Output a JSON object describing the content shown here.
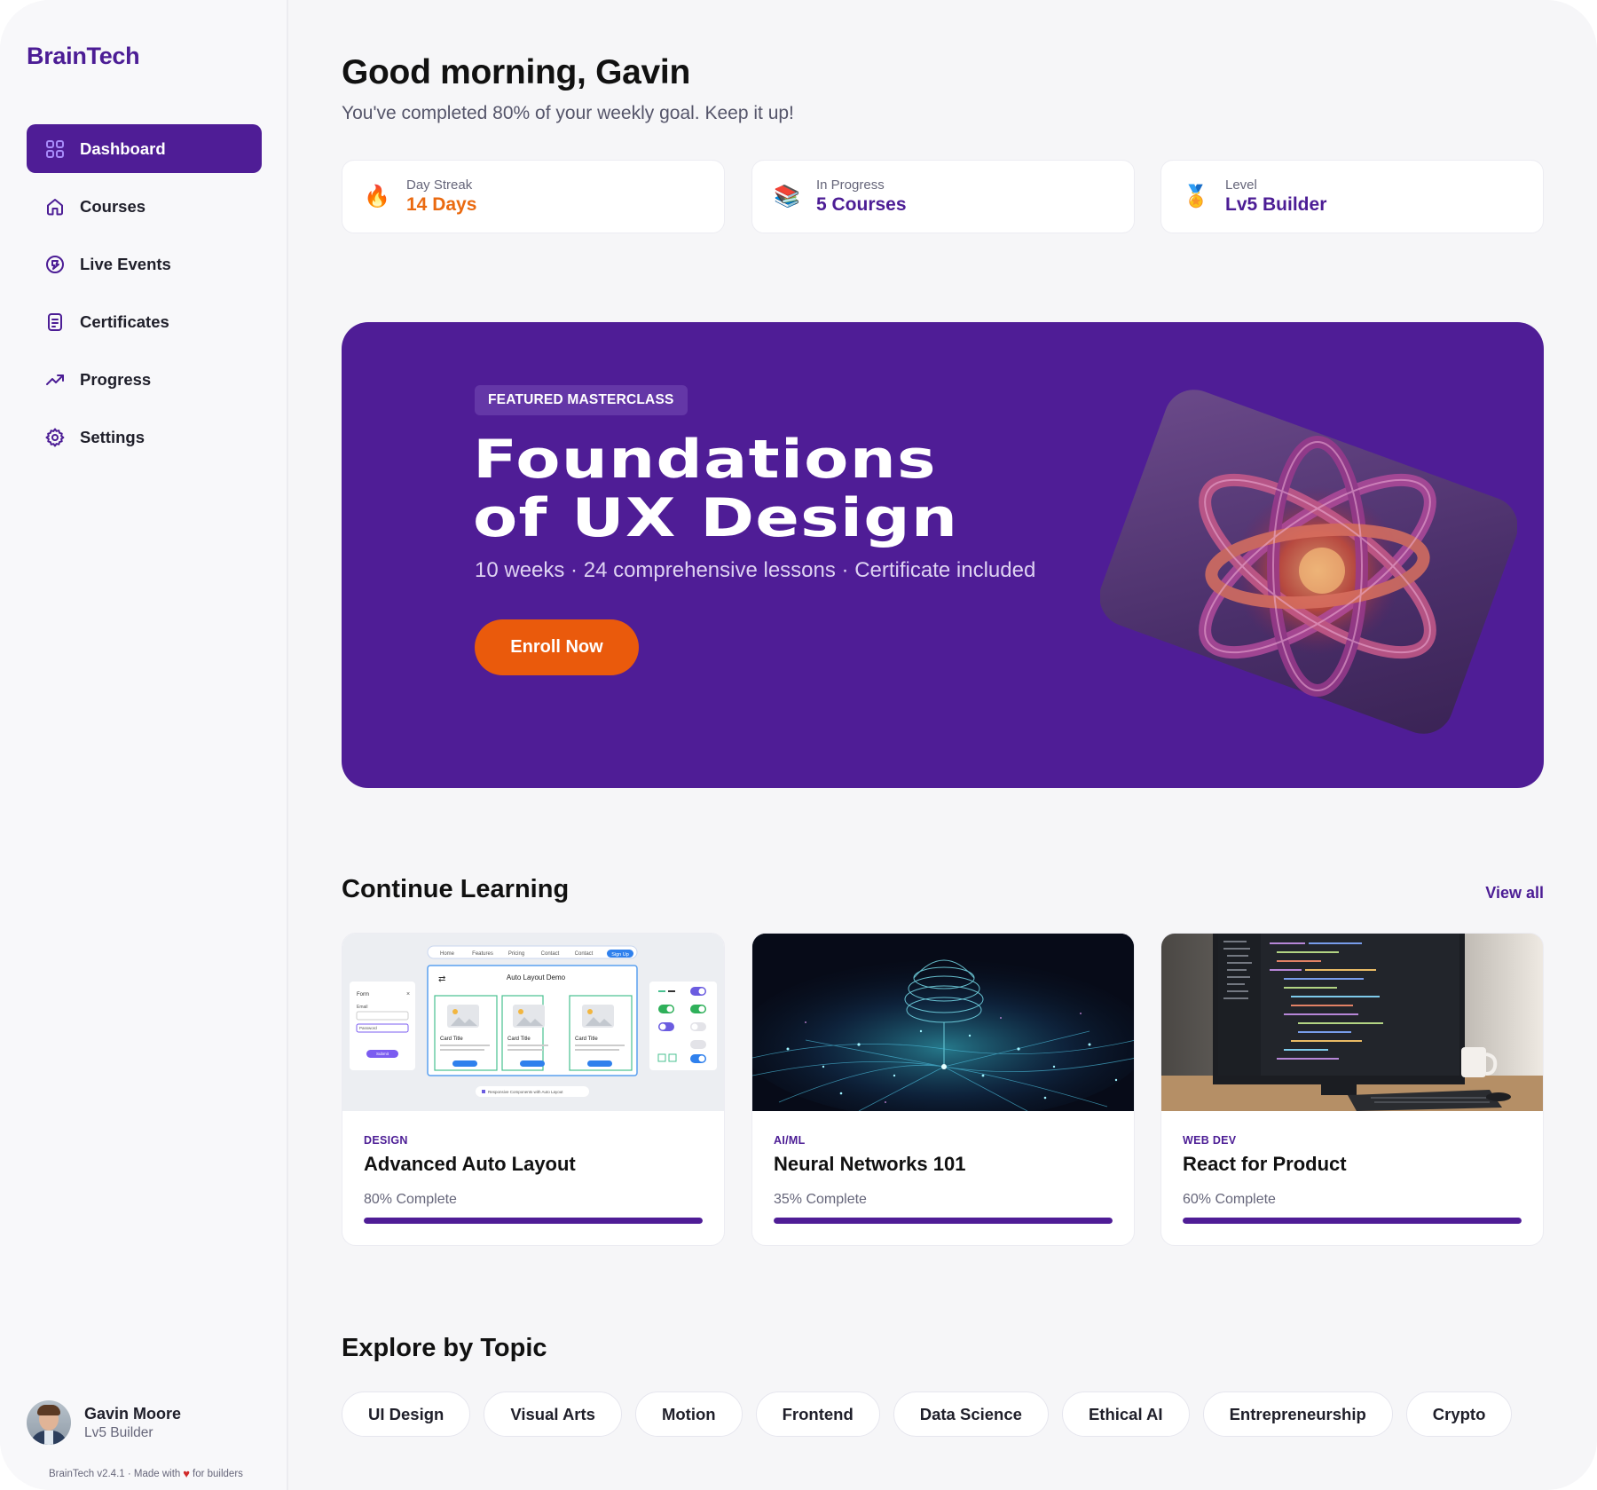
{
  "brand": "BrainTech",
  "nav": [
    {
      "label": "Dashboard",
      "icon": "dashboard-grid-icon",
      "active": true
    },
    {
      "label": "Courses",
      "icon": "home-icon"
    },
    {
      "label": "Live Events",
      "icon": "live-events-icon"
    },
    {
      "label": "Certificates",
      "icon": "certificate-document-icon"
    },
    {
      "label": "Progress",
      "icon": "trending-up-icon"
    },
    {
      "label": "Settings",
      "icon": "gear-icon"
    }
  ],
  "user": {
    "name": "Gavin Moore",
    "role": "Lv5 Builder"
  },
  "footer": {
    "prefix": "BrainTech v2.4.1 · Made with",
    "suffix": "for builders"
  },
  "greeting": {
    "title": "Good morning, Gavin",
    "subtitle": "You've completed 80% of your weekly goal. Keep it up!"
  },
  "stats": [
    {
      "label": "Day Streak",
      "value": "14 Days",
      "icon": "fire-icon",
      "emoji": "🔥"
    },
    {
      "label": "In Progress",
      "value": "5 Courses",
      "icon": "books-icon",
      "emoji": "📚"
    },
    {
      "label": "Level",
      "value": "Lv5 Builder",
      "icon": "medal-icon",
      "emoji": "🏅"
    }
  ],
  "hero": {
    "tag": "FEATURED MASTERCLASS",
    "title_line1": "Foundations",
    "title_line2": "of UX Design",
    "subtitle": "10 weeks · 24 comprehensive lessons · Certificate included",
    "cta": "Enroll Now"
  },
  "continue": {
    "title": "Continue Learning",
    "view_all": "View all"
  },
  "courses": [
    {
      "category": "DESIGN",
      "title": "Advanced Auto Layout",
      "progress_text": "80% Complete",
      "progress": 1.0,
      "thumb": {
        "demo_title": "Auto Layout Demo",
        "nav": [
          "Home",
          "Features",
          "Pricing",
          "Contact",
          "Contact",
          "Sign Up"
        ],
        "card_title": "Card Title",
        "button": "Learn More",
        "form_title": "Form",
        "email": "Email",
        "password": "Password",
        "submit": "Submit",
        "caption": "Responsive Components with Auto Layout"
      }
    },
    {
      "category": "AI/ML",
      "title": "Neural Networks 101",
      "progress_text": "35% Complete",
      "progress": 1.0
    },
    {
      "category": "WEB DEV",
      "title": "React for Product",
      "progress_text": "60% Complete",
      "progress": 1.0
    }
  ],
  "explore": {
    "title": "Explore by Topic"
  },
  "topics": [
    "UI Design",
    "Visual Arts",
    "Motion",
    "Frontend",
    "Data Science",
    "Ethical AI",
    "Entrepreneurship",
    "Crypto"
  ]
}
